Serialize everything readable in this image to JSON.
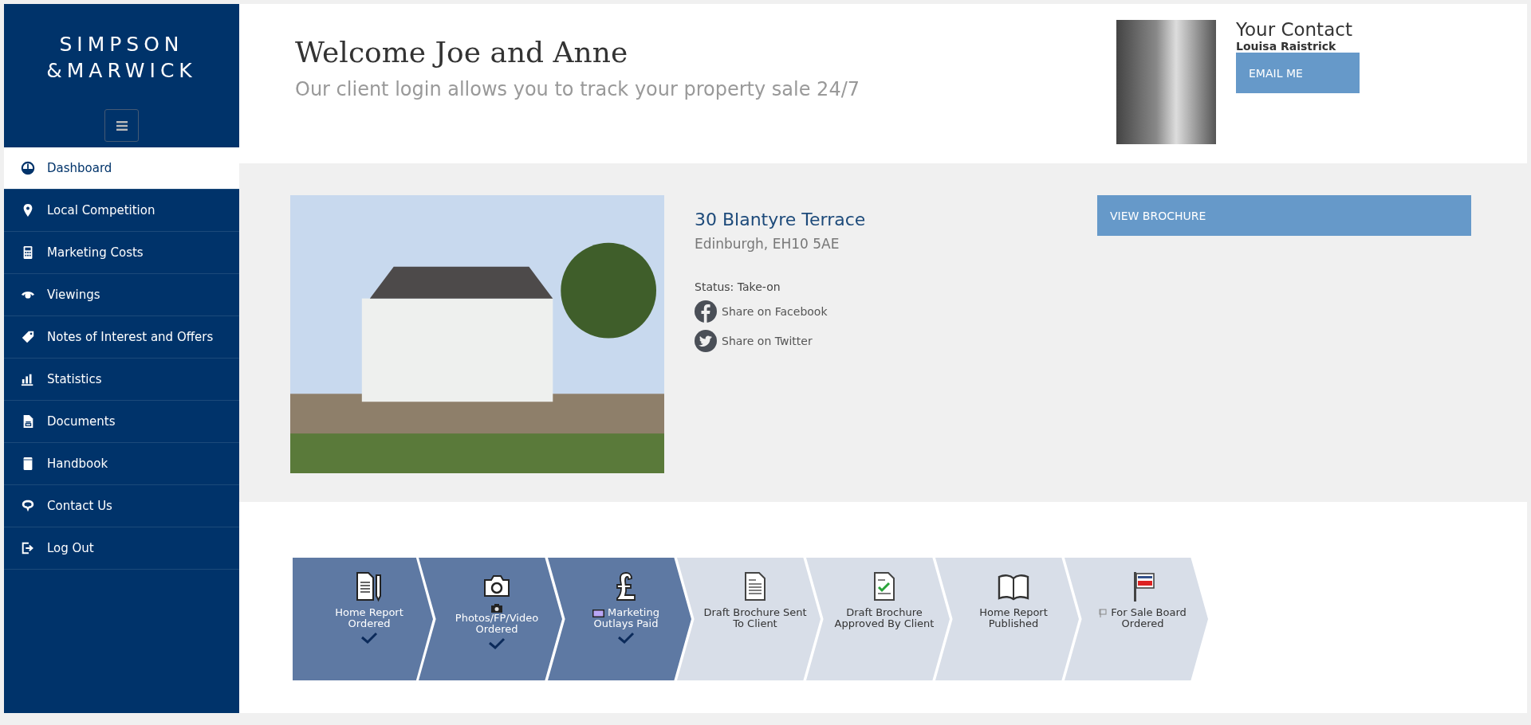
{
  "brand": {
    "line_1": "SIMPSON",
    "line_2": "&MARWICK"
  },
  "sidebar": {
    "items": [
      {
        "label": "Dashboard",
        "selected": true
      },
      {
        "label": "Local Competition",
        "selected": false
      },
      {
        "label": "Marketing Costs",
        "selected": false
      },
      {
        "label": "Viewings",
        "selected": false
      },
      {
        "label": "Notes of Interest and Offers",
        "selected": false
      },
      {
        "label": "Statistics",
        "selected": false
      },
      {
        "label": "Documents",
        "selected": false
      },
      {
        "label": "Handbook",
        "selected": false
      },
      {
        "label": "Contact Us",
        "selected": false
      },
      {
        "label": "Log Out",
        "selected": false
      }
    ]
  },
  "header": {
    "title": "Welcome Joe and Anne",
    "subtitle": "Our client login allows you to track your property sale 24/7"
  },
  "contact": {
    "heading": "Your Contact",
    "name": "Louisa Raistrick",
    "button": "EMAIL ME"
  },
  "property": {
    "address": "30 Blantyre Terrace",
    "locality": "Edinburgh, EH10 5AE",
    "status": "Status: Take-on",
    "share_facebook": "Share on Facebook",
    "share_twitter": "Share on Twitter",
    "brochure_button": "VIEW BROCHURE"
  },
  "progress": {
    "steps": [
      {
        "label": "Home Report Ordered",
        "done": true
      },
      {
        "label": "Photos/FP/Video Ordered",
        "done": true
      },
      {
        "label": "Marketing Outlays Paid",
        "done": true
      },
      {
        "label": "Draft Brochure Sent To Client",
        "done": false
      },
      {
        "label": "Draft Brochure Approved By Client",
        "done": false
      },
      {
        "label": "Home Report Published",
        "done": false
      },
      {
        "label": "For Sale Board Ordered",
        "done": false
      }
    ]
  }
}
